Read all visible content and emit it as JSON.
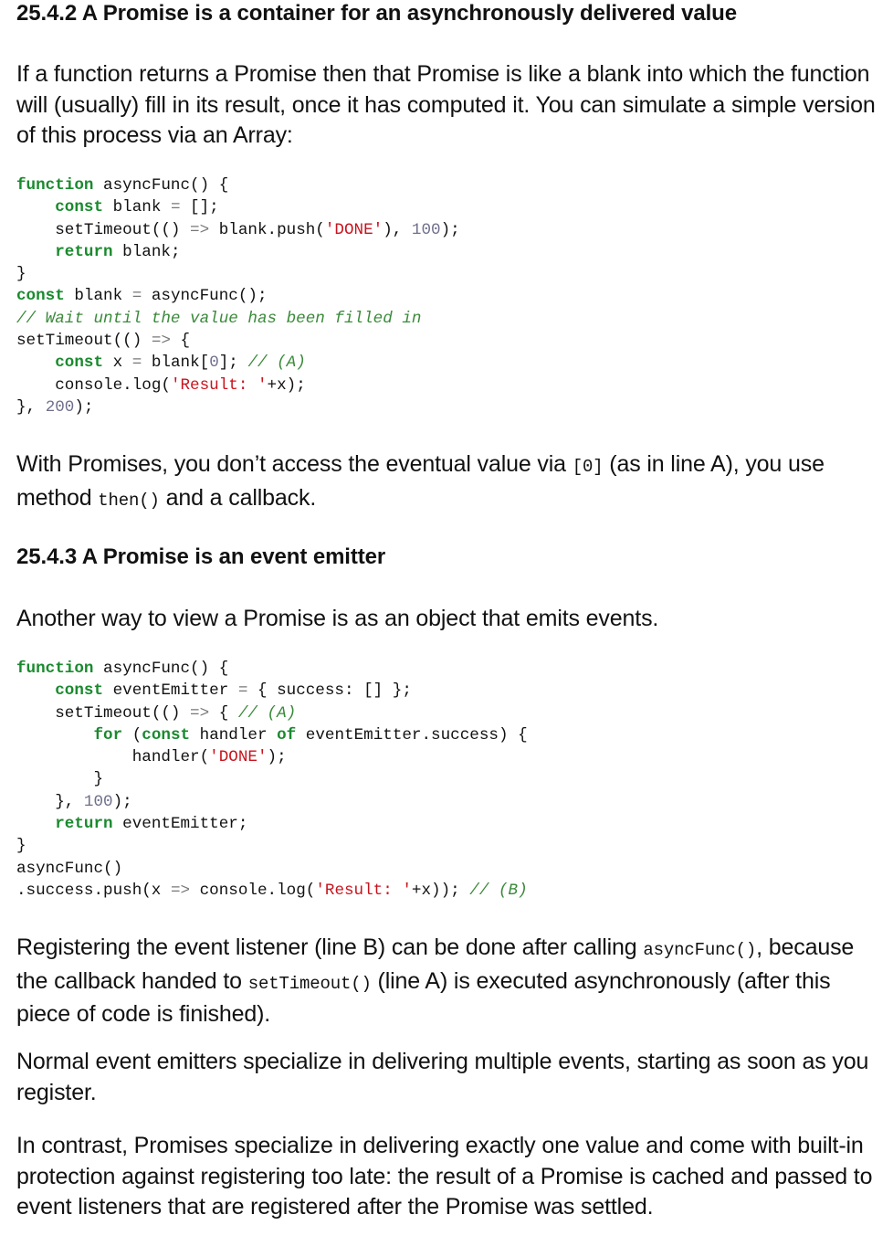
{
  "section_1": {
    "heading": "25.4.2 A Promise is a container for an asynchronously delivered value",
    "intro": "If a function returns a Promise then that Promise is like a blank into which the function will (usually) fill in its result, once it has computed it. You can simulate a simple version of this process via an Array:"
  },
  "code_1": {
    "l1_kw": "function",
    "l1_rest": " asyncFunc() {",
    "l2_kw": "const",
    "l2_a": " blank ",
    "l2_op": "=",
    "l2_b": " [];",
    "l3_a": "setTimeout(() ",
    "l3_op": "=>",
    "l3_b": " blank.push(",
    "l3_str": "'DONE'",
    "l3_c": "), ",
    "l3_num": "100",
    "l3_d": ");",
    "l4_kw": "return",
    "l4_rest": " blank;",
    "l5": "}",
    "l6_kw": "const",
    "l6_a": " blank ",
    "l6_op": "=",
    "l6_b": " asyncFunc();",
    "l7_cm": "// Wait until the value has been filled in",
    "l8_a": "setTimeout(() ",
    "l8_op": "=>",
    "l8_b": " {",
    "l9_kw": "const",
    "l9_a": " x ",
    "l9_op": "=",
    "l9_b": " blank[",
    "l9_num": "0",
    "l9_c": "]; ",
    "l9_cm": "// (A)",
    "l10_a": "console.log(",
    "l10_str": "'Result: '",
    "l10_b": "+x);",
    "l11_a": "}, ",
    "l11_num": "200",
    "l11_b": ");"
  },
  "para_2": {
    "a": "With Promises, you don’t access the eventual value via ",
    "code_a": "[0]",
    "b": " (as in line A), you use method ",
    "code_b": "then()",
    "c": " and a callback."
  },
  "section_2": {
    "heading": "25.4.3 A Promise is an event emitter",
    "intro": "Another way to view a Promise is as an object that emits events."
  },
  "code_2": {
    "l1_kw": "function",
    "l1_rest": " asyncFunc() {",
    "l2_kw": "const",
    "l2_a": " eventEmitter ",
    "l2_op": "=",
    "l2_b": " { success: [] };",
    "l3_a": "setTimeout(() ",
    "l3_op": "=>",
    "l3_b": " { ",
    "l3_cm": "// (A)",
    "l4_kw1": "for",
    "l4_a": " (",
    "l4_kw2": "const",
    "l4_b": " handler ",
    "l4_kw3": "of",
    "l4_c": " eventEmitter.success) {",
    "l5_a": "handler(",
    "l5_str": "'DONE'",
    "l5_b": ");",
    "l6": "}",
    "l7_a": "}, ",
    "l7_num": "100",
    "l7_b": ");",
    "l8_kw": "return",
    "l8_rest": " eventEmitter;",
    "l9": "}",
    "l10": "asyncFunc()",
    "l11_a": ".success.push(x ",
    "l11_op": "=>",
    "l11_b": " console.log(",
    "l11_str": "'Result: '",
    "l11_c": "+x)); ",
    "l11_cm": "// (B)"
  },
  "para_3": {
    "a": "Registering the event listener (line B) can be done after calling ",
    "code_a": "asyncFunc()",
    "b": ", because the callback handed to ",
    "code_b": "setTimeout()",
    "c": " (line A) is executed asynchronously (after this piece of code is finished)."
  },
  "para_4": "Normal event emitters specialize in delivering multiple events, starting as soon as you register.",
  "para_5": "In contrast, Promises specialize in delivering exactly one value and come with built-in protection against registering too late: the result of a Promise is cached and passed to event listeners that are registered after the Promise was settled."
}
